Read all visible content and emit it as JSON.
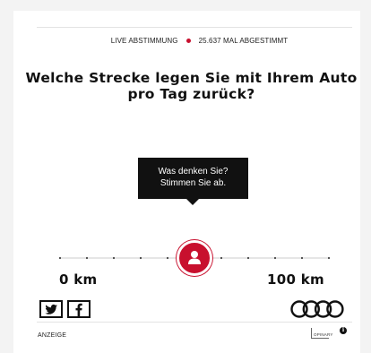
{
  "poll": {
    "status_label": "LIVE ABSTIMMUNG",
    "vote_count": "25.637 MAL ABGESTIMMT",
    "question": "Welche Strecke legen Sie mit Ihrem Auto pro Tag zurück?",
    "tooltip_line1": "Was denken Sie?",
    "tooltip_line2": "Stimmen Sie ab.",
    "slider_value_fraction": 0.5
  },
  "slider": {
    "min_label": "0 km",
    "max_label": "100 km",
    "tick_count": 10
  },
  "share": {
    "twitter_icon": "twitter-icon",
    "facebook_icon": "facebook-icon"
  },
  "footer": {
    "ad_label": "ANZEIGE",
    "provider": "OPINARY",
    "info_icon": "i"
  },
  "colors": {
    "accent": "#c8102e",
    "dark": "#111111",
    "background": "#f3f3f3"
  }
}
